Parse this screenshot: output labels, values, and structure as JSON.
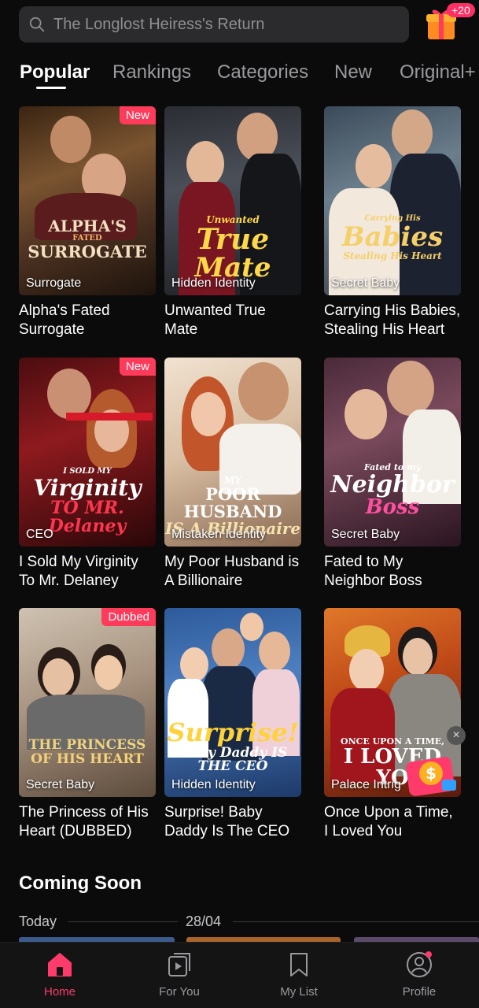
{
  "search": {
    "placeholder": "The Longlost Heiress's Return"
  },
  "gift": {
    "badge": "+20"
  },
  "tabs": [
    "Popular",
    "Rankings",
    "Categories",
    "New",
    "Original+"
  ],
  "cards": [
    {
      "title": "Alpha's Fated Surrogate",
      "genre": "Surrogate",
      "badge": "New",
      "art": [
        "ALPHA'S",
        "FATED",
        "SURROGATE"
      ]
    },
    {
      "title": "Unwanted True Mate",
      "genre": "Hidden Identity",
      "badge": "",
      "art": [
        "Unwanted",
        "True",
        "Mate"
      ]
    },
    {
      "title": "Carrying His Babies, Stealing His Heart",
      "genre": "Secret Baby",
      "badge": "",
      "art": [
        "Carrying His",
        "Babies",
        "Stealing His Heart"
      ]
    },
    {
      "title": "I Sold My Virginity To Mr. Delaney",
      "genre": "CEO",
      "badge": "New",
      "art": [
        "I SOLD MY",
        "Virginity",
        "TO MR. Delaney"
      ]
    },
    {
      "title": "My Poor Husband is A Billionaire",
      "genre": "Mistaken Identity",
      "badge": "",
      "art": [
        "MY",
        "POOR HUSBAND",
        "IS A Billionaire"
      ]
    },
    {
      "title": "Fated to My Neighbor Boss",
      "genre": "Secret Baby",
      "badge": "",
      "art": [
        "Fated to my",
        "Neighbor",
        "Boss"
      ]
    },
    {
      "title": "The Princess of His Heart (DUBBED)",
      "genre": "Secret Baby",
      "badge": "Dubbed",
      "art": [
        "THE PRINCESS",
        "OF HIS HEART",
        ""
      ]
    },
    {
      "title": "Surprise! Baby Daddy Is The CEO",
      "genre": "Hidden Identity",
      "badge": "",
      "art": [
        "Surprise!",
        "Baby Daddy IS THE CEO",
        ""
      ]
    },
    {
      "title": "Once Upon a Time, I Loved You",
      "genre": "Palace Intrig",
      "badge": "",
      "art": [
        "ONCE UPON A TIME,",
        "I LOVED YO",
        ""
      ]
    }
  ],
  "coming_soon": {
    "title": "Coming Soon",
    "dates": [
      "Today",
      "28/04"
    ]
  },
  "nav": [
    {
      "label": "Home",
      "icon": "home-icon",
      "active": true
    },
    {
      "label": "For You",
      "icon": "play-cards-icon",
      "active": false
    },
    {
      "label": "My List",
      "icon": "bookmark-icon",
      "active": false
    },
    {
      "label": "Profile",
      "icon": "profile-icon",
      "active": false
    }
  ],
  "colors": {
    "accent": "#ff3b6b",
    "badge": "#ff3b5c",
    "background": "#0b0b0c"
  },
  "promo": {
    "close": "×",
    "icon": "money-bag-icon"
  }
}
